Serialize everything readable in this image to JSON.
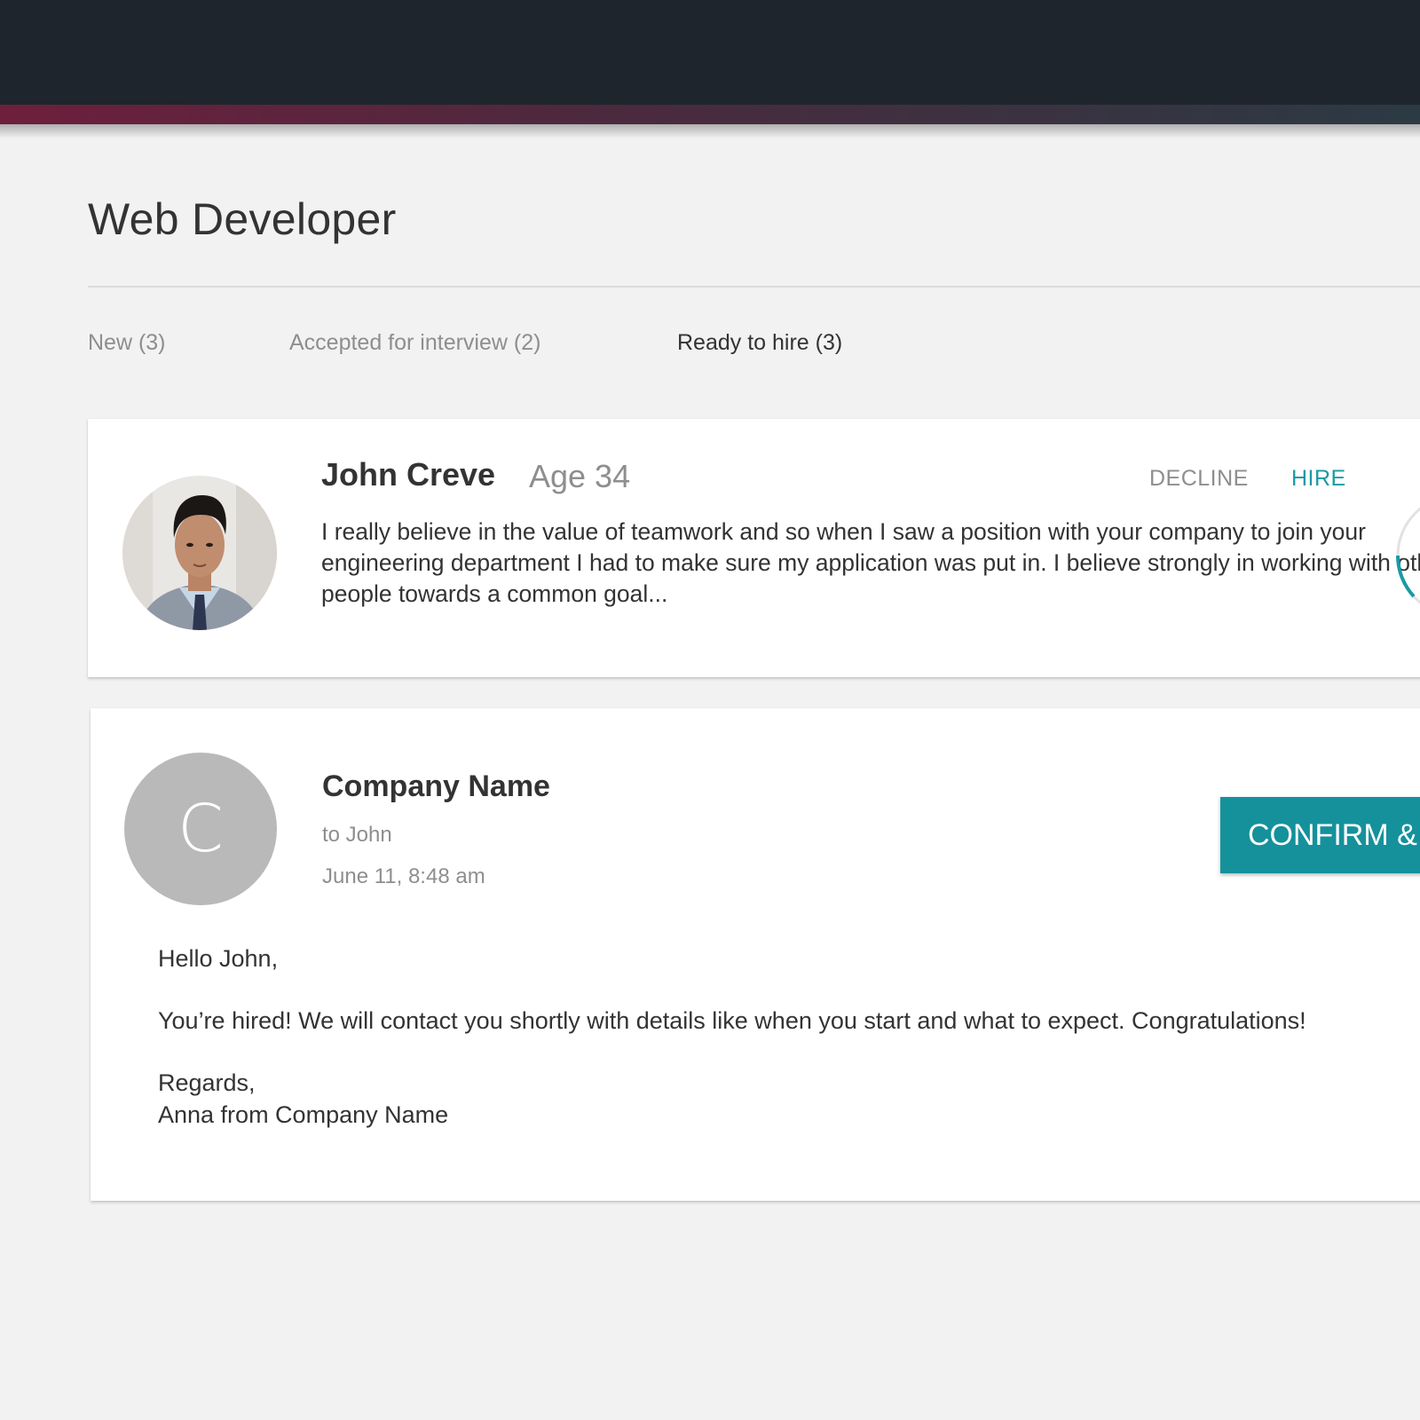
{
  "page": {
    "title": "Web Developer"
  },
  "tabs": [
    {
      "label": "New (3)",
      "active": false
    },
    {
      "label": "Accepted for interview (2)",
      "active": false
    },
    {
      "label": "Ready to hire (3)",
      "active": true
    }
  ],
  "candidate": {
    "name": "John Creve",
    "age": "Age 34",
    "decline_label": "DECLINE",
    "hire_label": "HIRE",
    "bio": "I really believe in the value of teamwork and so when I saw a position with your company to join your engineering department I had to make sure my application was put in.  I believe strongly in working with other people towards a common goal...",
    "avatar_icon": "person-photo-icon"
  },
  "message": {
    "avatar_letter": "C",
    "sender": "Company Name",
    "recipient": "to John",
    "date": "June 11, 8:48 am",
    "confirm_label": "CONFIRM &",
    "body": {
      "greeting": "Hello John,",
      "text": "You’re hired! We will contact you shortly with details like when you start and what to expect. Congratulations!",
      "closing": "Regards,",
      "signature": "Anna from Company Name"
    }
  },
  "colors": {
    "topbar": "#1e252d",
    "accent": "#15919c",
    "hire_link": "#1a9aa5",
    "muted_text": "#8e8e8e",
    "avatar_gray": "#b9b9b9"
  }
}
